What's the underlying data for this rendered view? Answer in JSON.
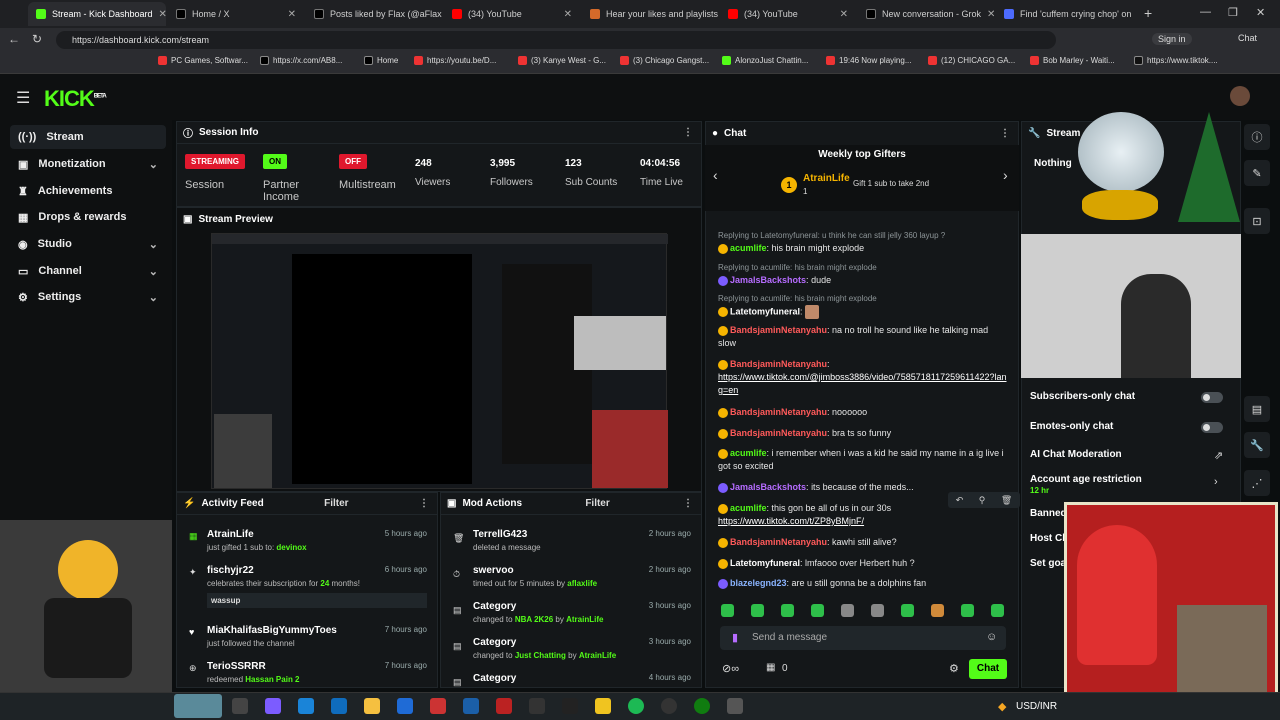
{
  "browser": {
    "tabs": [
      {
        "title": "Stream - Kick Dashboard",
        "color": "#53fc18",
        "active": true
      },
      {
        "title": "Home / X",
        "color": "#000000"
      },
      {
        "title": "Posts liked by Flax (@aFlaxLi",
        "color": "#000000"
      },
      {
        "title": "(34) YouTube",
        "color": "#ff0000"
      },
      {
        "title": "Hear your likes and playlists",
        "color": "#d46a2a"
      },
      {
        "title": "(34) YouTube",
        "color": "#ff0000"
      },
      {
        "title": "New conversation - Grok",
        "color": "#000000"
      },
      {
        "title": "Find 'cuffem crying chop' on",
        "color": "#4d6bfe"
      }
    ],
    "url": "https://dashboard.kick.com/stream",
    "sign_in": "Sign in",
    "chat_button": "Chat",
    "bookmarks": [
      "PC Games, Softwar...",
      "https://x.com/AB8...",
      "Home",
      "https://youtu.be/D...",
      "(3) Kanye West - G...",
      "(3) Chicago Gangst...",
      "AlonzoJust Chattin...",
      "19:46 Now playing...",
      "(12) CHICAGO GA...",
      "Bob Marley - Waiti...",
      "https://www.tiktok...."
    ]
  },
  "kick": {
    "logo": "KICK",
    "logo_sup": "BETA"
  },
  "sidebar": {
    "items": [
      {
        "label": "Stream",
        "icon": "broadcast-icon",
        "active": true,
        "chevron": false
      },
      {
        "label": "Monetization",
        "icon": "money-icon",
        "chevron": true
      },
      {
        "label": "Achievements",
        "icon": "trophy-icon",
        "chevron": false
      },
      {
        "label": "Drops & rewards",
        "icon": "gift-icon",
        "chevron": false
      },
      {
        "label": "Studio",
        "icon": "studio-icon",
        "chevron": true
      },
      {
        "label": "Channel",
        "icon": "channel-icon",
        "chevron": true
      },
      {
        "label": "Settings",
        "icon": "gear-icon",
        "chevron": true
      }
    ]
  },
  "session": {
    "title": "Session Info",
    "status": {
      "badge": "STREAMING",
      "label": "Session"
    },
    "partner": {
      "badge": "ON",
      "label": "Partner Income"
    },
    "multistream": {
      "badge": "OFF",
      "label": "Multistream"
    },
    "stats": [
      {
        "value": "248",
        "label": "Viewers"
      },
      {
        "value": "3,995",
        "label": "Followers"
      },
      {
        "value": "123",
        "label": "Sub Counts"
      },
      {
        "value": "04:04:56",
        "label": "Time Live"
      }
    ],
    "preview_title": "Stream Preview"
  },
  "activity": {
    "title": "Activity Feed",
    "filter": "Filter",
    "items": [
      {
        "name": "AtrainLife",
        "desc": "just gifted ",
        "bold": "1",
        "desc2": " sub to: ",
        "target": "devinox",
        "time": "5 hours ago",
        "icon": "gift-icon"
      },
      {
        "name": "fischyjr22",
        "desc": "celebrates their subscription for ",
        "bold": "24",
        "desc2": " months!",
        "target": "",
        "time": "6 hours ago",
        "note": "wassup",
        "icon": "star-icon"
      },
      {
        "name": "MiaKhalifasBigYummyToes",
        "desc": "just followed the channel",
        "time": "7 hours ago",
        "icon": "heart-icon"
      },
      {
        "name": "TerioSSRRR",
        "desc": "redeemed ",
        "target": "Hassan Pain 2",
        "time": "7 hours ago",
        "icon": "reward-icon"
      }
    ]
  },
  "mod": {
    "title": "Mod Actions",
    "filter": "Filter",
    "items": [
      {
        "name": "TerrellG423",
        "desc": "deleted a message",
        "time": "2 hours ago",
        "icon": "trash-icon"
      },
      {
        "name": "swervoo",
        "desc": "timed out for 5 minutes by ",
        "target": "aflaxlife",
        "time": "2 hours ago",
        "icon": "timeout-icon"
      },
      {
        "name": "Category",
        "desc": "changed to ",
        "target": "NBA 2K26",
        "by": " by ",
        "actor": "AtrainLife",
        "time": "3 hours ago",
        "icon": "category-icon"
      },
      {
        "name": "Category",
        "desc": "changed to ",
        "target": "Just Chatting",
        "by": " by ",
        "actor": "AtrainLife",
        "time": "3 hours ago",
        "icon": "category-icon"
      },
      {
        "name": "Category",
        "desc": "",
        "time": "4 hours ago",
        "icon": "category-icon"
      }
    ]
  },
  "chat": {
    "title": "Chat",
    "gifters_title": "Weekly top Gifters",
    "top_gifter": "AtrainLife",
    "top_gifter_count": "1",
    "gift_cta": "Gift 1 sub to take 2nd",
    "messages": [
      {
        "reply": "Replying to Latetomyfuneral: u think he can still jelly 360 layup ?",
        "user": "acumlife",
        "color": "#53fc18",
        "text": "his brain might explode"
      },
      {
        "reply": "Replying to acumlife: his brain might explode",
        "user": "JamalsBackshots",
        "color": "#b66cff",
        "text": "dude"
      },
      {
        "reply": "Replying to acumlife: his brain might explode",
        "user": "Latetomyfuneral",
        "color": "#ffffff",
        "text": ""
      },
      {
        "user": "BandsjaminNetanyahu",
        "color": "#ff5a5a",
        "text": "na no troll he sound like he talking mad slow"
      },
      {
        "user": "BandsjaminNetanyahu",
        "color": "#ff5a5a",
        "text": "",
        "link": "https://www.tiktok.com/@jimboss3886/video/7585718117259611422?lang=en"
      },
      {
        "user": "BandsjaminNetanyahu",
        "color": "#ff5a5a",
        "text": "noooooo"
      },
      {
        "user": "BandsjaminNetanyahu",
        "color": "#ff5a5a",
        "text": "bra ts so funny"
      },
      {
        "user": "acumlife",
        "color": "#53fc18",
        "text": "i remember when i was a kid he said my name in a ig live i got so excited"
      },
      {
        "user": "JamalsBackshots",
        "color": "#b66cff",
        "text": "its because of the meds..."
      },
      {
        "user": "acumlife",
        "color": "#53fc18",
        "text": "this gon be all of us in our 30s",
        "link": "https://www.tiktok.com/t/ZP8yBMjnF/"
      },
      {
        "user": "BandsjaminNetanyahu",
        "color": "#ff5a5a",
        "text": "kawhi still alive?"
      },
      {
        "user": "Latetomyfuneral",
        "color": "#ffffff",
        "text": "lmfaooo over Herbert huh ?"
      },
      {
        "user": "blazelegnd23",
        "color": "#8ab4ff",
        "text": "are u still gonna be a dolphins fan"
      }
    ],
    "input_placeholder": "Send a message",
    "points": "0",
    "send_label": "Chat"
  },
  "stream_panel": {
    "title": "Stream",
    "nothing": "Nothing",
    "items": [
      {
        "label": "Subscribers-only chat",
        "toggle": true
      },
      {
        "label": "Emotes-only chat",
        "toggle": true
      },
      {
        "label": "AI Chat Moderation",
        "toggle": false
      },
      {
        "label": "Account age restriction",
        "sub": "12 hr"
      },
      {
        "label": "Banned"
      },
      {
        "label": "Host Ch"
      },
      {
        "label": "Set goa"
      }
    ]
  },
  "taskbar": {
    "currency": "USD/INR"
  }
}
